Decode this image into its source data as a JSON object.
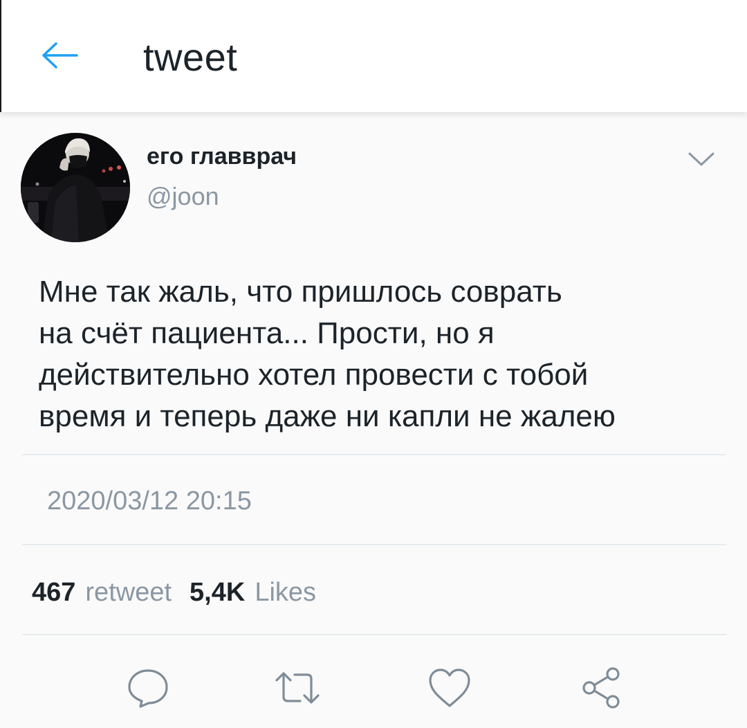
{
  "header": {
    "title": "tweet",
    "back_icon": "arrow-left-icon",
    "accent_color": "#1da1f2"
  },
  "author": {
    "name": "его главврач",
    "handle": "@joon",
    "avatar_icon": "avatar-photo"
  },
  "tweet": {
    "text_lines": [
      "Мне так жаль, что пришлось соврать",
      "на счёт пациента... Прости, но я",
      "действительно хотел провести с тобой",
      "время и теперь даже ни капли не жалею"
    ],
    "timestamp": "2020/03/12 20:15"
  },
  "stats": {
    "retweets_count": "467",
    "retweets_label": "retweet",
    "likes_count": "5,4K",
    "likes_label": "Likes"
  },
  "actions": {
    "icons": [
      "reply-icon",
      "retweet-icon",
      "like-icon",
      "share-icon"
    ],
    "icon_color": "#7f8c98"
  }
}
